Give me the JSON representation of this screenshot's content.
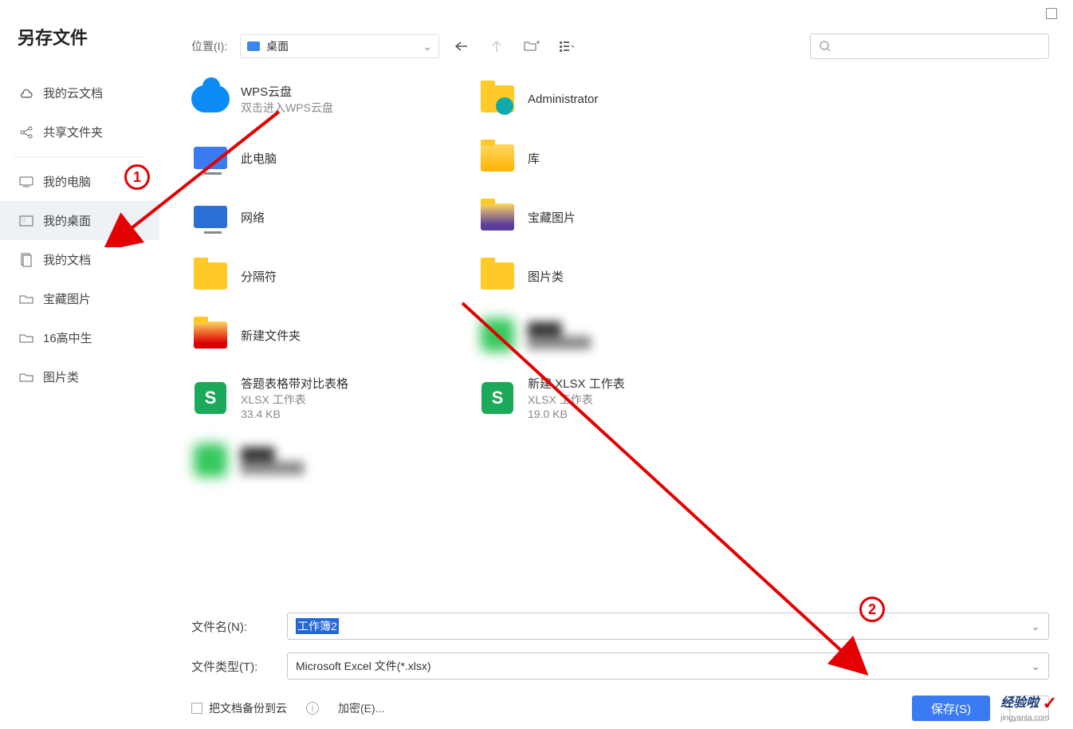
{
  "dialog": {
    "title": "另存文件"
  },
  "sidebar": {
    "groups": [
      [
        {
          "label": "我的云文档",
          "icon": "cloud"
        },
        {
          "label": "共享文件夹",
          "icon": "share"
        }
      ],
      [
        {
          "label": "我的电脑",
          "icon": "computer"
        },
        {
          "label": "我的桌面",
          "icon": "desktop",
          "selected": true
        },
        {
          "label": "我的文档",
          "icon": "documents"
        },
        {
          "label": "宝藏图片",
          "icon": "folder"
        },
        {
          "label": "16高中生",
          "icon": "folder"
        },
        {
          "label": "图片类",
          "icon": "folder"
        }
      ]
    ]
  },
  "toolbar": {
    "location_label": "位置(I):",
    "location_value": "桌面",
    "back": "←",
    "up": "↑",
    "newfolder": "⊕",
    "view": "≡",
    "search_placeholder": ""
  },
  "files": [
    {
      "name": "WPS云盘",
      "sub": "双击进入WPS云盘",
      "icon": "cloud"
    },
    {
      "name": "Administrator",
      "sub": "",
      "icon": "user-folder"
    },
    {
      "name": "此电脑",
      "sub": "",
      "icon": "pc"
    },
    {
      "name": "库",
      "sub": "",
      "icon": "library"
    },
    {
      "name": "网络",
      "sub": "",
      "icon": "network"
    },
    {
      "name": "宝藏图片",
      "sub": "",
      "icon": "folder-img"
    },
    {
      "name": "分隔符",
      "sub": "",
      "icon": "folder"
    },
    {
      "name": "图片类",
      "sub": "",
      "icon": "folder"
    },
    {
      "name": "新建文件夹",
      "sub": "",
      "icon": "folder-stripe"
    },
    {
      "name": "",
      "sub": "",
      "icon": "green",
      "blurred": true
    },
    {
      "name": "答题表格带对比表格",
      "sub": "XLSX 工作表",
      "sub2": "33.4 KB",
      "icon": "xlsx"
    },
    {
      "name": "新建 XLSX 工作表",
      "sub": "XLSX 工作表",
      "sub2": "19.0 KB",
      "icon": "xlsx"
    },
    {
      "name": "",
      "sub": "",
      "icon": "green",
      "blurred": true
    }
  ],
  "form": {
    "filename_label": "文件名(N):",
    "filename_value": "工作簿2",
    "filetype_label": "文件类型(T):",
    "filetype_value": "Microsoft Excel 文件(*.xlsx)",
    "backup_label": "把文档备份到云",
    "encrypt_label": "加密(E)...",
    "save_label": "保存(S)",
    "cancel_label": ""
  },
  "annotations": {
    "marker1": "1",
    "marker2": "2"
  },
  "branding": {
    "name": "经验啦",
    "url": "jingyanla.com"
  }
}
